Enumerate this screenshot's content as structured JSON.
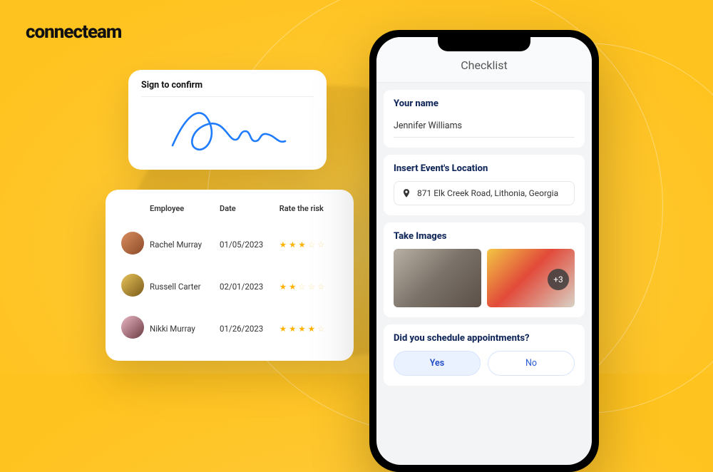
{
  "brand": "connecteam",
  "signature_card": {
    "title": "Sign to confirm"
  },
  "risk_table": {
    "headers": {
      "employee": "Employee",
      "date": "Date",
      "rate": "Rate the risk"
    },
    "rows": [
      {
        "name": "Rachel Murray",
        "date": "01/05/2023",
        "stars": 3
      },
      {
        "name": "Russell Carter",
        "date": "02/01/2023",
        "stars": 2
      },
      {
        "name": "Nikki Murray",
        "date": "01/26/2023",
        "stars": 4
      }
    ]
  },
  "phone": {
    "header": "Checklist",
    "sections": {
      "name": {
        "label": "Your name",
        "value": "Jennifer Williams"
      },
      "location": {
        "label": "Insert Event's Location",
        "value": "871 Elk Creek Road, Lithonia, Georgia"
      },
      "images": {
        "label": "Take Images",
        "extra_count_badge": "+3"
      },
      "appointments": {
        "label": "Did you schedule appointments?",
        "yes": "Yes",
        "no": "No"
      }
    }
  }
}
